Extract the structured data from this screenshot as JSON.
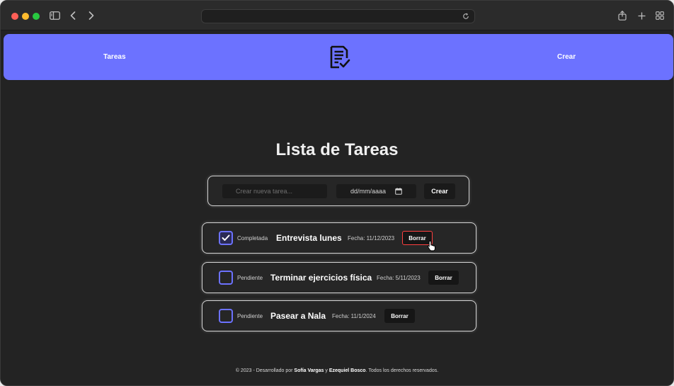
{
  "browser": {
    "icons": [
      "sidebar-icon",
      "back-icon",
      "forward-icon",
      "reload-icon",
      "share-icon",
      "new-tab-icon",
      "tab-overview-icon"
    ]
  },
  "navbar": {
    "left_link": "Tareas",
    "right_link": "Crear",
    "logo_icon": "task-list-icon",
    "color": "#6c72ff"
  },
  "main": {
    "title": "Lista de Tareas",
    "form": {
      "task_placeholder": "Crear nueva tarea...",
      "date_value": "dd/mm/aaaa",
      "create_label": "Crear"
    },
    "tasks": [
      {
        "status": "Completada",
        "name": "Entrevista lunes",
        "date": "Fecha: 11/12/2023",
        "delete_label": "Borrar",
        "checked": true
      },
      {
        "status": "Pendiente",
        "name": "Terminar ejercicios física",
        "date": "Fecha: 5/11/2023",
        "delete_label": "Borrar",
        "checked": false
      },
      {
        "status": "Pendiente",
        "name": "Pasear a Nala",
        "date": "Fecha: 11/1/2024",
        "delete_label": "Borrar",
        "checked": false
      }
    ]
  },
  "footer": {
    "prefix": "© 2023 - Desarrollado por ",
    "author1": "Sofía Vargas",
    "joiner": " y ",
    "author2": "Ezequiel Bosco",
    "suffix": ". Todos los derechos reservados."
  },
  "colors": {
    "accent": "#6c72ff",
    "background": "#232323",
    "hover_border": "#ff4040"
  }
}
